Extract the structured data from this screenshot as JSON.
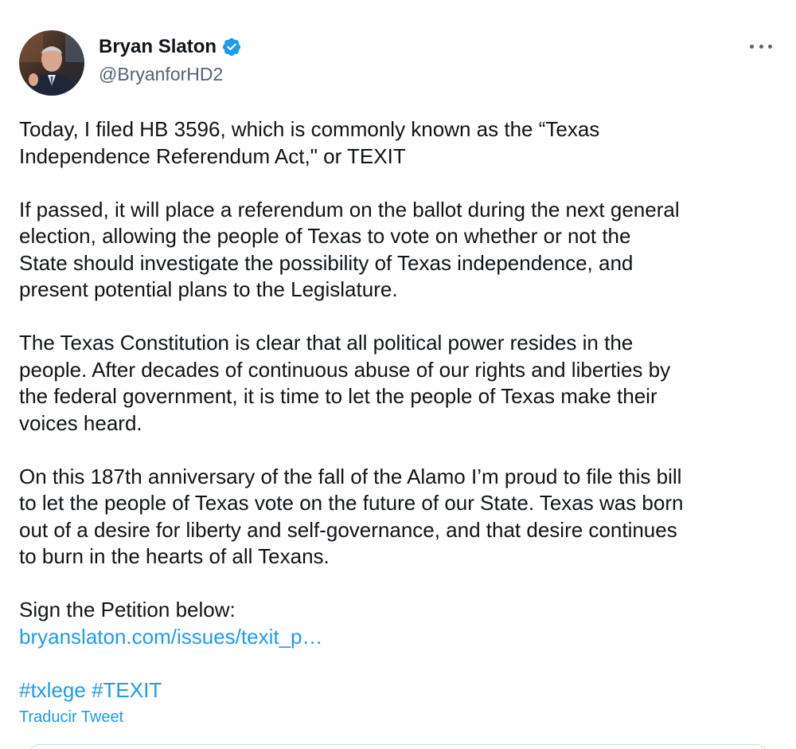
{
  "author": {
    "name": "Bryan Slaton",
    "handle": "@BryanforHD2",
    "verified": true
  },
  "tweet": {
    "paragraphs": [
      "Today, I filed HB 3596, which is commonly known as the “Texas\nIndependence Referendum Act,\" or TEXIT",
      "If passed, it will place a referendum on the ballot during the next general\nelection, allowing the people of Texas to vote on whether or not the\nState should investigate the possibility of Texas independence, and\npresent potential plans to the Legislature.",
      "The Texas Constitution is clear that all political power resides in the\npeople. After decades of continuous abuse of our rights and liberties by\nthe federal government, it is time to let the people of Texas make their\nvoices heard.",
      "On this 187th anniversary of the fall of the Alamo I’m proud to file this bill\nto let the people of Texas vote on the future of our State. Texas was born\nout of a desire for liberty and self-governance, and that desire continues\nto burn in the hearts of all Texans."
    ],
    "petition_label": "Sign the Petition below:",
    "petition_link": "bryanslaton.com/issues/texit_p…",
    "hashtags": [
      "#txlege",
      "#TEXIT"
    ],
    "translate_label": "Traducir Tweet"
  },
  "icons": {
    "verified": "verified-badge-icon",
    "more": "more-options-icon"
  },
  "colors": {
    "accent": "#1d9bf0",
    "text": "#0f1419",
    "secondary": "#536471"
  }
}
